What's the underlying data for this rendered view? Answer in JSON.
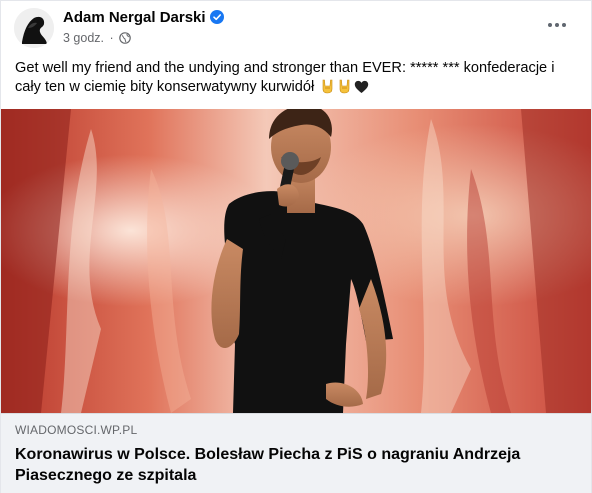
{
  "post": {
    "author": "Adam Nergal Darski",
    "time": "3 godz.",
    "separator": "·",
    "text": "Get well my friend and the undying and stronger than EVER: ***** *** konfederacje i cały ten w ciemię bity konserwatywny kurwidół",
    "emoji_icons": [
      "horns-hand-icon",
      "horns-hand-icon",
      "black-heart-icon"
    ]
  },
  "link_preview": {
    "domain": "WIADOMOSCI.WP.PL",
    "headline": "Koronawirus w Polsce. Bolesław Piecha z PiS o nagraniu Andrzeja Piasecznego ze szpitala"
  },
  "colors": {
    "verified": "#1877f2",
    "meta_text": "#65676b",
    "preview_bg": "#f0f2f5"
  }
}
